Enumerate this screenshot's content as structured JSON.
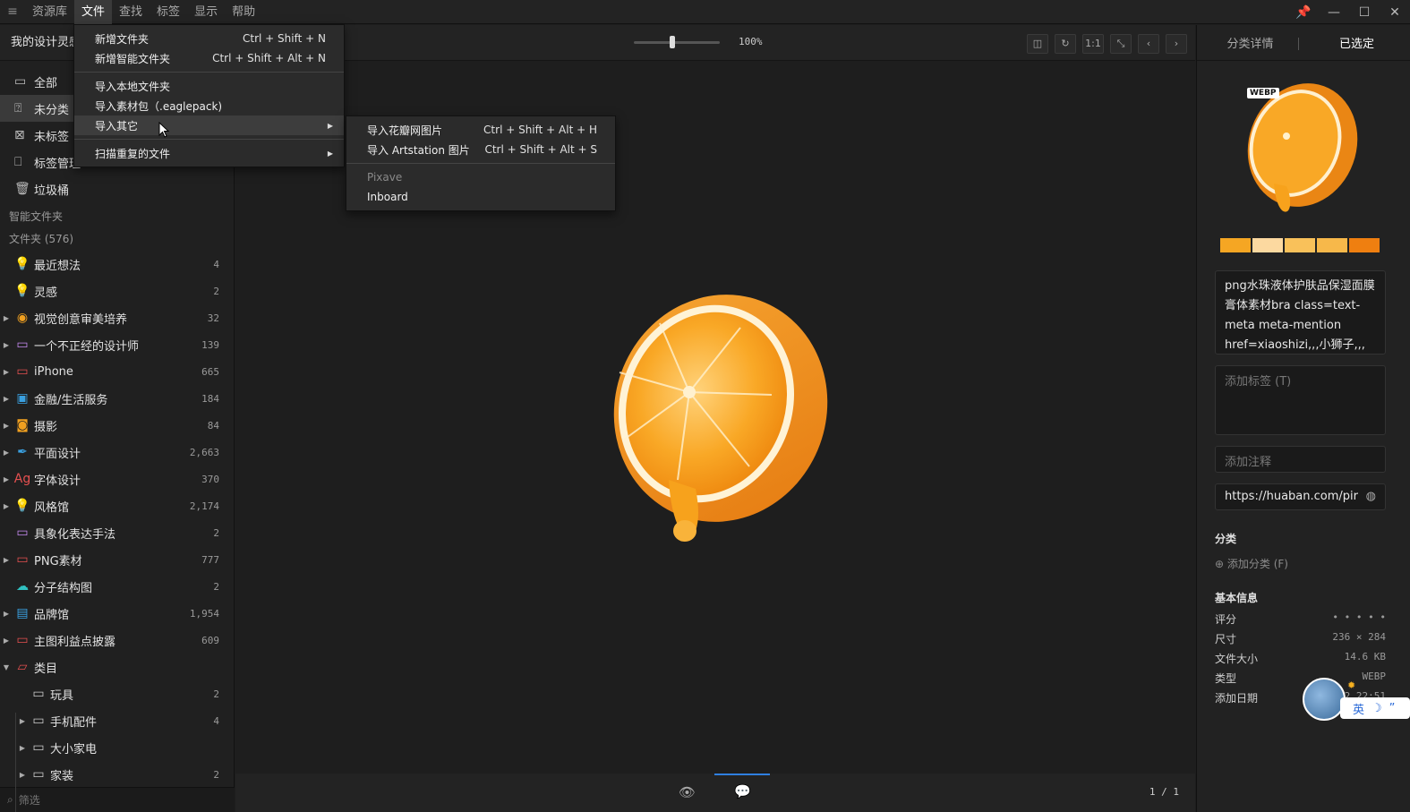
{
  "menubar": {
    "items": [
      "资源库",
      "文件",
      "查找",
      "标签",
      "显示",
      "帮助"
    ],
    "active_index": 1
  },
  "library": {
    "title": "我的设计灵感"
  },
  "sidebar": {
    "system": [
      {
        "label": "全部",
        "icon": "inbox-icon"
      },
      {
        "label": "未分类",
        "icon": "question-icon",
        "selected": true
      },
      {
        "label": "未标签",
        "icon": "tag-off-icon"
      },
      {
        "label": "标签管理",
        "icon": "bookmark-icon"
      },
      {
        "label": "垃圾桶",
        "icon": "trash-icon"
      }
    ],
    "smart_folders_title": "智能文件夹",
    "folders_title": "文件夹 (576)",
    "folders": [
      {
        "label": "最近想法",
        "count": "4",
        "color": "#c58af0",
        "icon": "lightbulb-icon",
        "arrow": false
      },
      {
        "label": "灵感",
        "count": "2",
        "color": "#f2c230",
        "icon": "lightbulb-icon",
        "arrow": false
      },
      {
        "label": "视觉创意审美培养",
        "count": "32",
        "color": "#f0a020",
        "icon": "eye-icon",
        "arrow": true
      },
      {
        "label": "一个不正经的设计师",
        "count": "139",
        "color": "#c58af0",
        "icon": "folder-icon",
        "arrow": true
      },
      {
        "label": "iPhone",
        "count": "665",
        "color": "#e55050",
        "icon": "folder-icon",
        "arrow": true
      },
      {
        "label": "金融/生活服务",
        "count": "184",
        "color": "#3aa0e0",
        "icon": "wallet-icon",
        "arrow": true
      },
      {
        "label": "摄影",
        "count": "84",
        "color": "#f0a020",
        "icon": "camera-icon",
        "arrow": true
      },
      {
        "label": "平面设计",
        "count": "2,663",
        "color": "#3aa0e0",
        "icon": "pen-icon",
        "arrow": true
      },
      {
        "label": "字体设计",
        "count": "370",
        "color": "#e55050",
        "icon": "font-icon",
        "arrow": true
      },
      {
        "label": "风格馆",
        "count": "2,174",
        "color": "#f0a020",
        "icon": "lightbulb-icon",
        "arrow": true
      },
      {
        "label": "具象化表达手法",
        "count": "2",
        "color": "#c58af0",
        "icon": "folder-icon",
        "arrow": false
      },
      {
        "label": "PNG素材",
        "count": "777",
        "color": "#e55050",
        "icon": "folder-icon",
        "arrow": true
      },
      {
        "label": "分子结构图",
        "count": "2",
        "color": "#30c0c0",
        "icon": "cloud-icon",
        "arrow": false
      },
      {
        "label": "品牌馆",
        "count": "1,954",
        "color": "#3aa0e0",
        "icon": "book-icon",
        "arrow": true
      },
      {
        "label": "主图利益点披露",
        "count": "609",
        "color": "#e55050",
        "icon": "folder-icon",
        "arrow": true
      },
      {
        "label": "类目",
        "count": "",
        "color": "#e55050",
        "icon": "folder-open-icon",
        "arrow": true,
        "open": true
      },
      {
        "label": "玩具",
        "count": "2",
        "color": "#cccccc",
        "icon": "folder-icon",
        "arrow": false,
        "child": true
      },
      {
        "label": "手机配件",
        "count": "4",
        "color": "#cccccc",
        "icon": "folder-icon",
        "arrow": true,
        "child": true
      },
      {
        "label": "大小家电",
        "count": "",
        "color": "#cccccc",
        "icon": "folder-icon",
        "arrow": true,
        "child": true
      },
      {
        "label": "家装",
        "count": "2",
        "color": "#cccccc",
        "icon": "folder-icon",
        "arrow": true,
        "child": true
      }
    ],
    "filter_placeholder": "筛选"
  },
  "toolbar": {
    "zoom_percent": "100%",
    "zoom_fraction": 0.45
  },
  "file_menu": {
    "items": [
      {
        "label": "新增文件夹",
        "shortcut": "Ctrl + Shift + N"
      },
      {
        "label": "新增智能文件夹",
        "shortcut": "Ctrl + Shift + Alt + N"
      },
      {
        "sep": true
      },
      {
        "label": "导入本地文件夹",
        "shortcut": ""
      },
      {
        "label": "导入素材包（.eaglepack)",
        "shortcut": ""
      },
      {
        "label": "导入其它",
        "shortcut": "",
        "submenu": true,
        "highlight": true
      },
      {
        "sep": true
      },
      {
        "label": "扫描重复的文件",
        "shortcut": "",
        "submenu": true
      }
    ]
  },
  "import_submenu": {
    "items": [
      {
        "label": "导入花瓣网图片",
        "shortcut": "Ctrl + Shift + Alt + H"
      },
      {
        "label": "导入 Artstation 图片",
        "shortcut": "Ctrl + Shift + Alt + S"
      },
      {
        "sep": true
      },
      {
        "label": "Pixave",
        "shortcut": "",
        "disabled": true
      },
      {
        "label": "Inboard",
        "shortcut": ""
      }
    ]
  },
  "viewer": {
    "pager": "1 / 1"
  },
  "right_panel": {
    "tabs": [
      "分类详情",
      "已选定"
    ],
    "active_tab": 1,
    "badge": "WEBP",
    "swatches": [
      "#f5a623",
      "#fcd9a0",
      "#f9c15a",
      "#f7b84a",
      "#ef7f10"
    ],
    "name": "png水珠液体护肤品保湿面膜膏体素材bra class=text-meta meta-mention href=xiaoshizi,,,小狮子,,,",
    "tags_placeholder": "添加标签 (T)",
    "note_placeholder": "添加注释",
    "url": "https://huaban.com/pir",
    "category_label": "分类",
    "add_category": "添加分类 (F)",
    "basic_info_label": "基本信息",
    "info": [
      {
        "k": "评分",
        "v": "• • • • •"
      },
      {
        "k": "尺寸",
        "v": "236 × 284"
      },
      {
        "k": "文件大小",
        "v": "14.6 KB"
      },
      {
        "k": "类型",
        "v": "WEBP"
      },
      {
        "k": "添加日期",
        "v": "202   22:51"
      }
    ]
  },
  "ime": {
    "label": "英"
  }
}
